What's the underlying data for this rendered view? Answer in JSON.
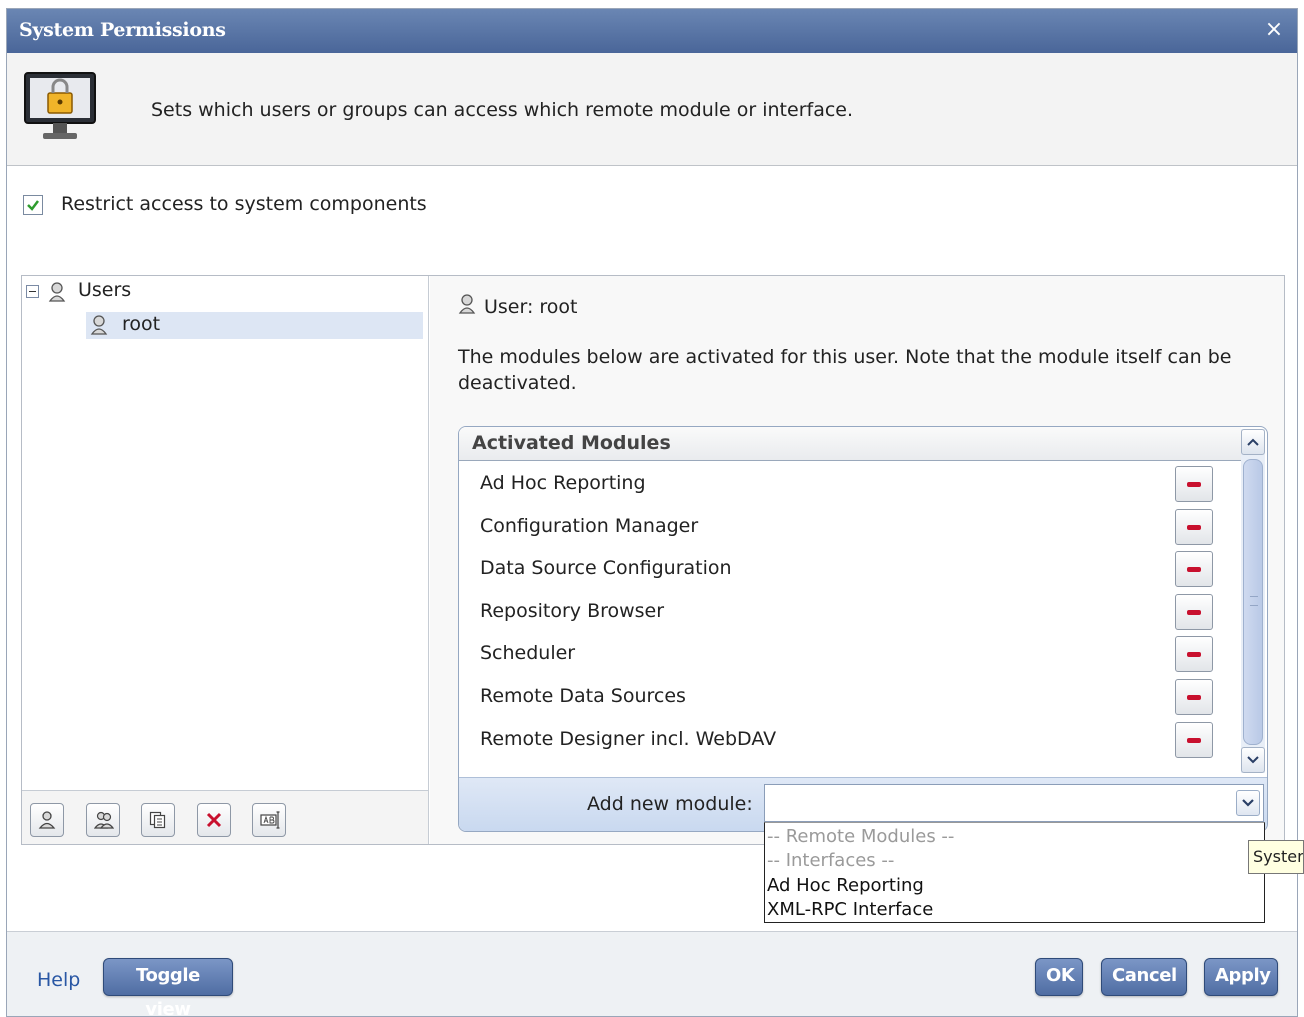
{
  "dialog": {
    "title": "System Permissions",
    "close_label": "×",
    "description": "Sets which users or groups can access which remote module or interface."
  },
  "restrict": {
    "checked": true,
    "label": "Restrict access to system components"
  },
  "tree": {
    "root_label": "Users",
    "items": [
      {
        "label": "root",
        "selected": true
      }
    ]
  },
  "left_toolbar": {
    "buttons": [
      "add-user-icon",
      "add-group-icon",
      "copy-icon",
      "delete-icon",
      "rename-icon"
    ]
  },
  "detail": {
    "user_heading": "User: root",
    "note": "The modules below are activated for this user. Note that the module itself can be deactivated."
  },
  "modules": {
    "header": "Activated Modules",
    "items": [
      "Ad Hoc Reporting",
      "Configuration Manager",
      "Data Source Configuration",
      "Repository Browser",
      "Scheduler",
      "Remote Data Sources",
      "Remote Designer incl. WebDAV"
    ]
  },
  "add_module": {
    "label": "Add new module:",
    "value": "",
    "options": [
      {
        "text": "-- Remote Modules --",
        "kind": "header"
      },
      {
        "text": "-- Interfaces --",
        "kind": "header"
      },
      {
        "text": "Ad Hoc Reporting",
        "kind": "option"
      },
      {
        "text": "XML-RPC Interface",
        "kind": "option"
      }
    ]
  },
  "tooltip": "Syster",
  "footer": {
    "help": "Help",
    "toggle_view": "Toggle view",
    "ok": "OK",
    "cancel": "Cancel",
    "apply": "Apply"
  },
  "colors": {
    "titlebar": "#4a6699",
    "accent_button": "#4f6da3",
    "remove_icon": "#c8102e",
    "checkbox_check": "#2e9c2e",
    "link": "#2957a4"
  }
}
